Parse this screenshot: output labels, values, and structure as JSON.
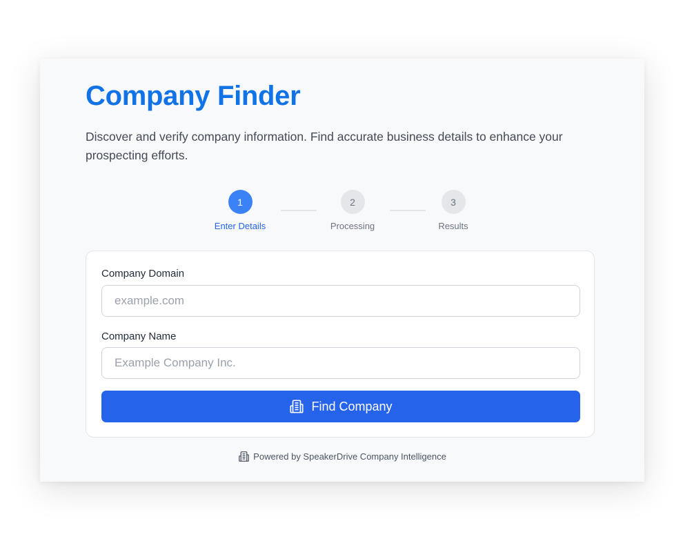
{
  "header": {
    "title": "Company Finder",
    "description": "Discover and verify company information. Find accurate business details to enhance your prospecting efforts."
  },
  "stepper": {
    "steps": [
      {
        "number": "1",
        "label": "Enter Details",
        "active": true
      },
      {
        "number": "2",
        "label": "Processing",
        "active": false
      },
      {
        "number": "3",
        "label": "Results",
        "active": false
      }
    ]
  },
  "form": {
    "domain": {
      "label": "Company Domain",
      "placeholder": "example.com",
      "value": ""
    },
    "name": {
      "label": "Company Name",
      "placeholder": "Example Company Inc.",
      "value": ""
    },
    "submit_label": "Find Company",
    "submit_icon": "building-icon"
  },
  "footer": {
    "text": "Powered by SpeakerDrive Company Intelligence",
    "icon": "building-icon"
  },
  "colors": {
    "accent": "#2563eb",
    "title": "#1273e6",
    "step_active": "#3b82f6",
    "step_inactive": "#e4e6ea"
  }
}
